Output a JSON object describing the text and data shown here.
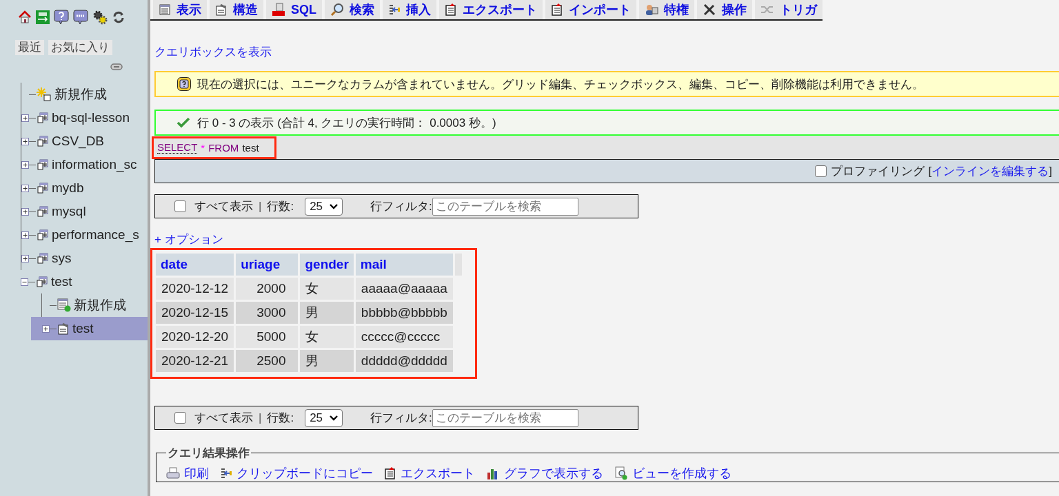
{
  "sidebar": {
    "quick_tabs": [
      {
        "label": "最近"
      },
      {
        "label": "お気に入り"
      }
    ],
    "tree": [
      {
        "label": "新規作成",
        "kind": "new",
        "selected": false
      },
      {
        "label": "bq-sql-lesson",
        "kind": "database",
        "expanded": false,
        "selected": false
      },
      {
        "label": "CSV_DB",
        "kind": "database",
        "expanded": false,
        "selected": false
      },
      {
        "label": "information_sc",
        "kind": "database",
        "expanded": false,
        "selected": false
      },
      {
        "label": "mydb",
        "kind": "database",
        "expanded": false,
        "selected": false
      },
      {
        "label": "mysql",
        "kind": "database",
        "expanded": false,
        "selected": false
      },
      {
        "label": "performance_s",
        "kind": "database",
        "expanded": false,
        "selected": false
      },
      {
        "label": "sys",
        "kind": "database",
        "expanded": false,
        "selected": false
      },
      {
        "label": "test",
        "kind": "database",
        "expanded": true,
        "selected": false,
        "children": [
          {
            "label": "新規作成",
            "kind": "new-table",
            "selected": false
          },
          {
            "label": "test",
            "kind": "table",
            "expanded": false,
            "selected": true
          }
        ]
      }
    ]
  },
  "tabs": [
    {
      "label": "表示"
    },
    {
      "label": "構造"
    },
    {
      "label": "SQL"
    },
    {
      "label": "検索"
    },
    {
      "label": "挿入"
    },
    {
      "label": "エクスポート"
    },
    {
      "label": "インポート"
    },
    {
      "label": "特権"
    },
    {
      "label": "操作"
    },
    {
      "label": "トリガ"
    }
  ],
  "query_box_link": "クエリボックスを表示",
  "notice": "現在の選択には、ユニークなカラムが含まれていません。グリッド編集、チェックボックス、編集、コピー、削除機能は利用できません。",
  "success": "行 0 - 3 の表示 (合計 4, クエリの実行時間： 0.0003 秒。)",
  "sql": [
    {
      "text": "SELECT",
      "kind": "keyword"
    },
    {
      "text": "*",
      "kind": "operator"
    },
    {
      "text": "FROM",
      "kind": "keyword"
    },
    {
      "text": "test",
      "kind": "identifier"
    }
  ],
  "profiling": {
    "checked": false,
    "label": "プロファイリング",
    "open": "[",
    "link": "インラインを編集する",
    "close": "]"
  },
  "nav_bars": [
    {
      "show_all": "すべて表示",
      "checked": false,
      "separator": "|",
      "rows_label": "行数:",
      "rows_value": "25",
      "filter_label": "行フィルタ:",
      "filter_placeholder": "このテーブルを検索"
    },
    {
      "show_all": "すべて表示",
      "checked": false,
      "separator": "|",
      "rows_label": "行数:",
      "rows_value": "25",
      "filter_label": "行フィルタ:",
      "filter_placeholder": "このテーブルを検索"
    }
  ],
  "options_link": "+ オプション",
  "table": {
    "columns": [
      "date",
      "uriage",
      "gender",
      "mail"
    ],
    "rows": [
      [
        "2020-12-12",
        "2000",
        "女",
        "aaaaa@aaaaa"
      ],
      [
        "2020-12-15",
        "3000",
        "男",
        "bbbbb@bbbbb"
      ],
      [
        "2020-12-20",
        "5000",
        "女",
        "ccccc@ccccc"
      ],
      [
        "2020-12-21",
        "2500",
        "男",
        "ddddd@ddddd"
      ]
    ]
  },
  "result_ops": {
    "legend": "クエリ結果操作",
    "links": [
      "印刷",
      "クリップボードにコピー",
      "エクスポート",
      "グラフで表示する",
      "ビューを作成する"
    ]
  }
}
